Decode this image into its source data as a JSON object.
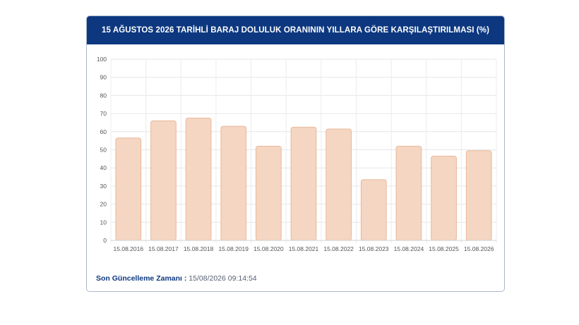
{
  "header": {
    "title": "15 AĞUSTOS 2026 TARİHLİ BARAJ DOLULUK ORANININ YILLARA GÖRE KARŞILAŞTIRILMASI (%)"
  },
  "footer": {
    "label": "Son Güncelleme Zamanı :",
    "value": "15/08/2026 09:14:54"
  },
  "colors": {
    "header_bg": "#0d3880",
    "bar_fill": "#f5d6c2",
    "bar_stroke": "#e8b89b"
  },
  "chart_data": {
    "type": "bar",
    "categories": [
      "15.08.2016",
      "15.08.2017",
      "15.08.2018",
      "15.08.2019",
      "15.08.2020",
      "15.08.2021",
      "15.08.2022",
      "15.08.2023",
      "15.08.2024",
      "15.08.2025",
      "15.08.2026"
    ],
    "values": [
      56.5,
      66,
      67.5,
      63,
      52,
      62.5,
      61.5,
      33.5,
      52,
      46.5,
      49.5
    ],
    "title": "",
    "xlabel": "",
    "ylabel": "",
    "ylim": [
      0,
      100
    ],
    "yticks": [
      0,
      10,
      20,
      30,
      40,
      50,
      60,
      70,
      80,
      90,
      100
    ],
    "grid": true,
    "legend": "none"
  }
}
